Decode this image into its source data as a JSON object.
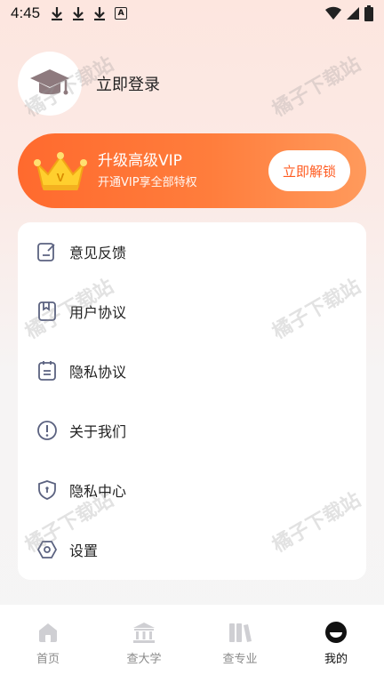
{
  "status_bar": {
    "time": "4:45",
    "left_icons": [
      "download-icon",
      "download-icon",
      "download-icon",
      "a-icon"
    ],
    "right_icons": [
      "wifi-icon",
      "signal-icon",
      "battery-icon"
    ]
  },
  "profile": {
    "login_label": "立即登录",
    "avatar_icon": "graduation-cap-icon"
  },
  "vip": {
    "title": "升级高级VIP",
    "subtitle": "开通VIP享全部特权",
    "button": "立即解锁",
    "crown_letter": "V",
    "gradient_start": "#ff6a2e",
    "gradient_end": "#ff9a5c",
    "button_text_color": "#ff5a1f"
  },
  "menu": {
    "items": [
      {
        "label": "意见反馈",
        "icon": "feedback-icon"
      },
      {
        "label": "用户协议",
        "icon": "user-agreement-icon"
      },
      {
        "label": "隐私协议",
        "icon": "privacy-agreement-icon"
      },
      {
        "label": "关于我们",
        "icon": "info-icon"
      },
      {
        "label": "隐私中心",
        "icon": "shield-icon"
      },
      {
        "label": "设置",
        "icon": "settings-icon"
      }
    ]
  },
  "watermark": "橘子下载站",
  "tabs": [
    {
      "label": "首页",
      "icon": "home-icon",
      "active": false
    },
    {
      "label": "查大学",
      "icon": "university-icon",
      "active": false
    },
    {
      "label": "查专业",
      "icon": "books-icon",
      "active": false
    },
    {
      "label": "我的",
      "icon": "profile-icon",
      "active": true
    }
  ]
}
